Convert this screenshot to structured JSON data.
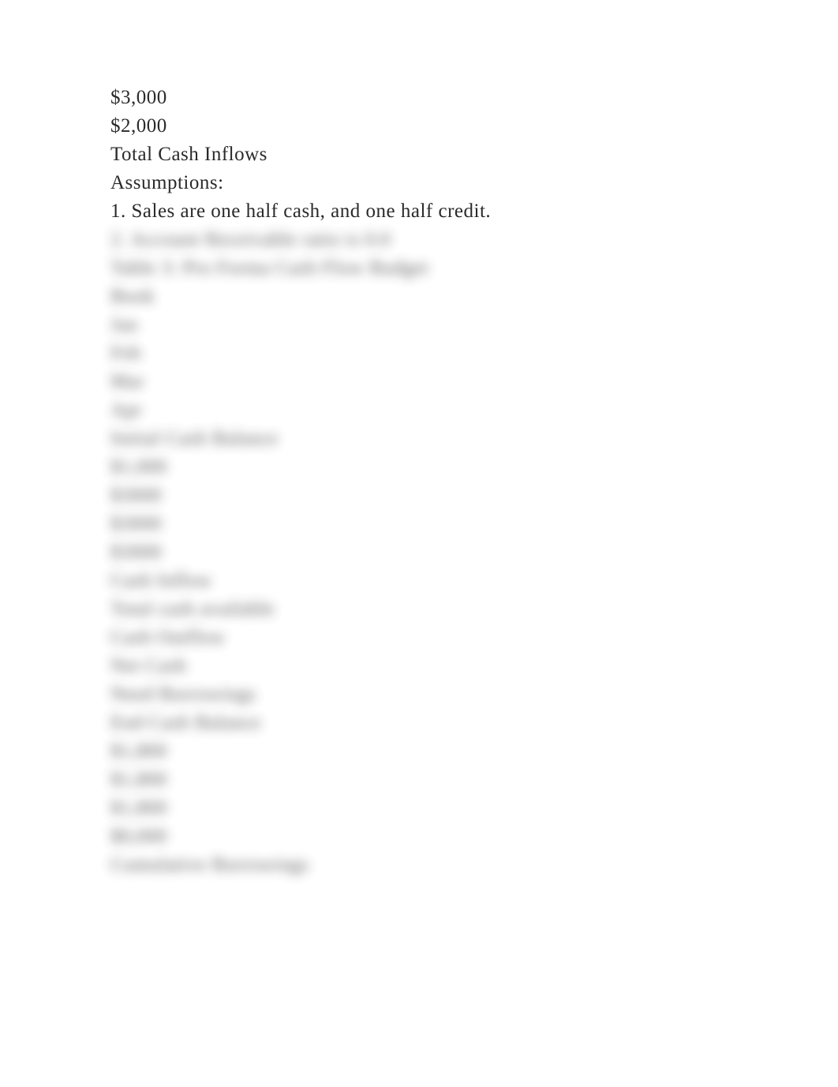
{
  "lines": [
    {
      "text": "$3,000",
      "blurred": false
    },
    {
      "text": "$2,000",
      "blurred": false
    },
    {
      "text": "Total Cash Inflows",
      "blurred": false
    },
    {
      "text": "Assumptions:",
      "blurred": false
    },
    {
      "text": "1. Sales are one half cash, and one half credit.",
      "blurred": false
    },
    {
      "text": "2. Account Receivable ratio is 0.0",
      "blurred": true
    },
    {
      "text": "Table 3: Pro Forma Cash Flow Budget",
      "blurred": true
    },
    {
      "text": "Book",
      "blurred": true
    },
    {
      "text": "Jan",
      "blurred": true
    },
    {
      "text": "Feb",
      "blurred": true
    },
    {
      "text": "Mar",
      "blurred": true
    },
    {
      "text": "Apr",
      "blurred": true
    },
    {
      "text": "Initial Cash Balance",
      "blurred": true
    },
    {
      "text": "$1,000",
      "blurred": true
    },
    {
      "text": "$3000",
      "blurred": true
    },
    {
      "text": "$3000",
      "blurred": true
    },
    {
      "text": "$3000",
      "blurred": true
    },
    {
      "text": "Cash Inflow",
      "blurred": true
    },
    {
      "text": "Total cash available",
      "blurred": true
    },
    {
      "text": "Cash Outflow",
      "blurred": true
    },
    {
      "text": "Net Cash",
      "blurred": true
    },
    {
      "text": "Need Borrowings",
      "blurred": true
    },
    {
      "text": "End Cash Balance",
      "blurred": true
    },
    {
      "text": "$1,800",
      "blurred": true
    },
    {
      "text": "$1,800",
      "blurred": true
    },
    {
      "text": "$1,800",
      "blurred": true
    },
    {
      "text": "$0,000",
      "blurred": true
    },
    {
      "text": "Cumulative Borrowings",
      "blurred": true
    }
  ]
}
